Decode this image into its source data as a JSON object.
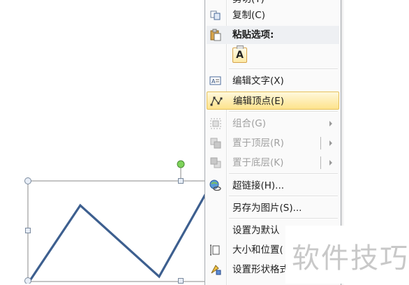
{
  "menu": {
    "items": [
      {
        "label": "剪切(T)",
        "icon": "cut-icon",
        "disabled": false
      },
      {
        "label": "复制(C)",
        "icon": "copy-icon",
        "disabled": false
      },
      {
        "label": "粘贴选项:",
        "icon": "paste-icon",
        "disabled": false
      },
      {
        "label": "编辑文字(X)",
        "icon": "edit-text-icon",
        "disabled": false
      },
      {
        "label": "编辑顶点(E)",
        "icon": "edit-points-icon",
        "disabled": false,
        "highlighted": true
      },
      {
        "label": "组合(G)",
        "icon": "group-icon",
        "disabled": true,
        "submenu": true
      },
      {
        "label": "置于顶层(R)",
        "icon": "bring-to-front-icon",
        "disabled": true,
        "submenu": true
      },
      {
        "label": "置于底层(K)",
        "icon": "send-to-back-icon",
        "disabled": true,
        "submenu": true
      },
      {
        "label": "超链接(H)...",
        "icon": "hyperlink-icon",
        "disabled": false
      },
      {
        "label": "另存为图片(S)...",
        "icon": "",
        "disabled": false
      },
      {
        "label": "设置为默认",
        "icon": "",
        "disabled": false
      },
      {
        "label": "大小和位置(",
        "icon": "size-position-icon",
        "disabled": false
      },
      {
        "label": "设置形状格式",
        "icon": "format-shape-icon",
        "disabled": false
      }
    ],
    "paste_option": "A"
  },
  "watermark": "软件技巧",
  "colors": {
    "shape_line": "#3a5a8a",
    "highlight": "#fde38c",
    "rotate_handle": "#6cc04a"
  }
}
